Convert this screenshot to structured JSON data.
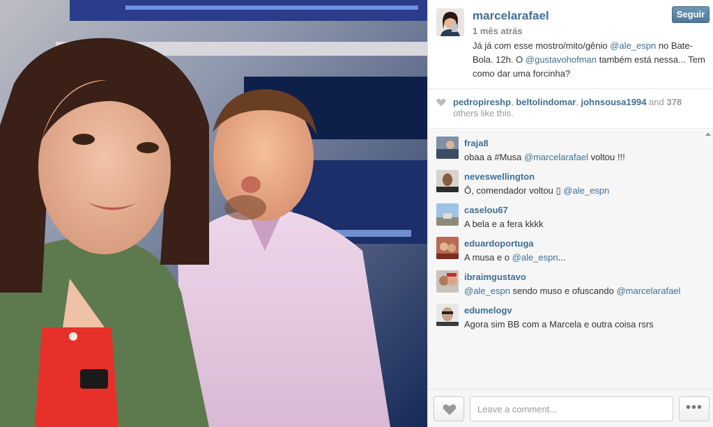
{
  "post": {
    "username": "marcelarafael",
    "time": "1 mês atrás",
    "follow_label": "Seguir",
    "caption_parts": {
      "p1": "Já já com esse mostro/mito/gênio ",
      "m1": "@ale_espn",
      "p2": " no Bate-Bola. 12h. O ",
      "m2": "@gustavohofman",
      "p3": " também está nessa... Tem como dar uma forcinha?"
    }
  },
  "likes": {
    "users": [
      "pedropireshp",
      "beltolindomar",
      "johnsousa1994"
    ],
    "sep": ", ",
    "and": " and ",
    "count": "378",
    "suffix": " others like this."
  },
  "comments": [
    {
      "user": "fraja8",
      "text_before": "obaa a #Musa ",
      "mention": "@marcelarafael",
      "text_after": " voltou !!!"
    },
    {
      "user": "neveswellington",
      "text_before": "Ô, comendador voltou ▯ ",
      "mention": "@ale_espn",
      "text_after": ""
    },
    {
      "user": "caselou67",
      "text_before": "A bela e a fera kkkk",
      "mention": "",
      "text_after": ""
    },
    {
      "user": "eduardoportuga",
      "text_before": "A musa e o ",
      "mention": "@ale_espn",
      "text_after": "..."
    },
    {
      "user": "ibraimgustavo",
      "text_before": "",
      "mention": "@ale_espn",
      "text_after": " sendo muso e ofuscando ",
      "mention2": "@marcelarafael"
    },
    {
      "user": "edumelogv",
      "text_before": "Agora sim BB com a Marcela e outra coisa rsrs",
      "mention": "",
      "text_after": ""
    }
  ],
  "footer": {
    "comment_placeholder": "Leave a comment...",
    "more_label": "•••"
  },
  "icons": {
    "like": "heart-icon",
    "more": "ellipsis-icon",
    "scroll": "scroll-up-icon"
  },
  "colors": {
    "link": "#3f6f93",
    "follow_button": "#5a83a5",
    "muted": "#999999"
  }
}
